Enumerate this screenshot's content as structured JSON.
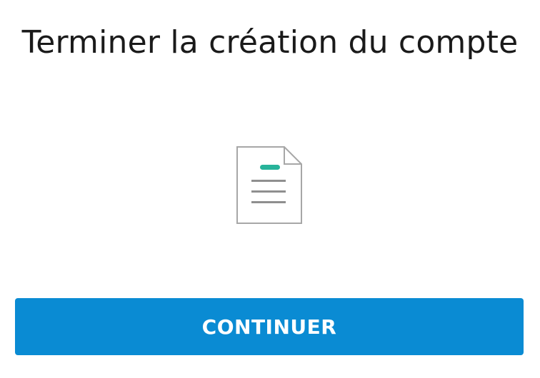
{
  "header": {
    "title": "Terminer la création du compte"
  },
  "illustration": {
    "icon": "document-icon",
    "accent_color": "#27b39a"
  },
  "actions": {
    "continue_label": "CONTINUER",
    "continue_color": "#0a8bd3"
  }
}
